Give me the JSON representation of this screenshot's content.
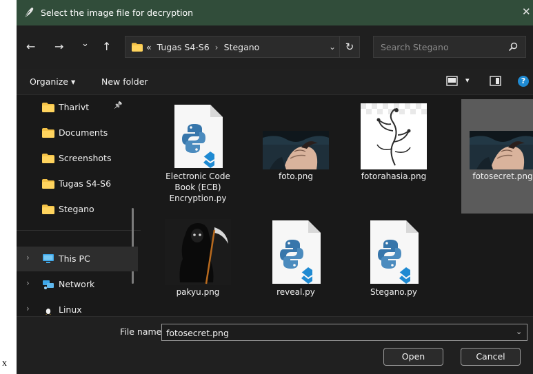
{
  "page": {
    "stray_text": "x"
  },
  "titlebar": {
    "title": "Select the image file for decryption",
    "close": "✕"
  },
  "nav": {
    "back": "←",
    "forward": "→",
    "recent": "⌄",
    "up": "↑",
    "breadcrumb_prefix": "«",
    "path": [
      "Tugas S4-S6",
      "Stegano"
    ],
    "path_sep": "›",
    "path_dropdown": "⌄",
    "refresh": "↻",
    "search_placeholder": "Search Stegano"
  },
  "toolbar": {
    "organize": "Organize ▾",
    "new_folder": "New folder",
    "view_dropdown": "▾",
    "help": "?"
  },
  "sidebar": {
    "items": [
      {
        "label": "Tharivt",
        "icon": "folder-icon",
        "pinned": true,
        "pin_glyph": "📌"
      },
      {
        "label": "Documents",
        "icon": "folder-icon"
      },
      {
        "label": "Screenshots",
        "icon": "folder-icon"
      },
      {
        "label": "Tugas S4-S6",
        "icon": "folder-icon"
      },
      {
        "label": "Stegano",
        "icon": "folder-icon"
      }
    ],
    "locations": [
      {
        "label": "This PC",
        "icon": "monitor-icon",
        "expander": "›"
      },
      {
        "label": "Network",
        "icon": "network-icon",
        "expander": "›"
      },
      {
        "label": "Linux",
        "icon": "linux-icon",
        "expander": "›"
      }
    ]
  },
  "files": [
    {
      "name": "Electronic Code Book (ECB) Encryption.py",
      "kind": "python"
    },
    {
      "name": "foto.png",
      "kind": "anime-image"
    },
    {
      "name": "fotorahasia.png",
      "kind": "ornament-image"
    },
    {
      "name": "fotosecret.png",
      "kind": "anime-image",
      "selected": true
    },
    {
      "name": "pakyu.png",
      "kind": "reaper-image"
    },
    {
      "name": "reveal.py",
      "kind": "python"
    },
    {
      "name": "Stegano.py",
      "kind": "python"
    }
  ],
  "footer": {
    "filename_label": "File name:",
    "filename_value": "fotosecret.png",
    "filename_dropdown": "⌄",
    "open_label": "Open",
    "cancel_label": "Cancel"
  },
  "colors": {
    "titlebar": "#314d3a",
    "background": "#191919",
    "selection": "#5b5b5b",
    "folder": "#f4c247",
    "python_blue": "#3776ab",
    "python_yellow": "#4b8bbe",
    "vscode_blue": "#1f8ad2"
  }
}
